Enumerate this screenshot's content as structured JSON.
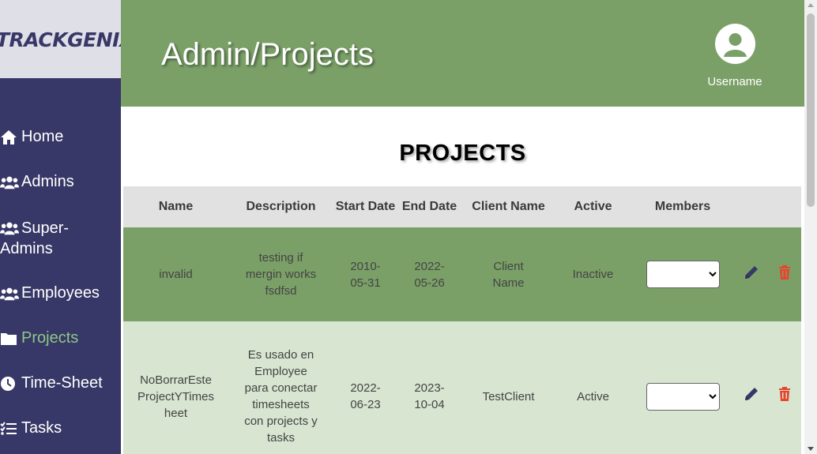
{
  "app": {
    "logo": "TRACKGENIX"
  },
  "sidebar": {
    "items": [
      {
        "label": "Home",
        "icon": "home-icon"
      },
      {
        "label": "Admins",
        "icon": "users-icon"
      },
      {
        "label": "Super-Admins",
        "label_line1": "Super-",
        "label_line2": "Admins",
        "icon": "users-icon"
      },
      {
        "label": "Employees",
        "icon": "users-icon"
      },
      {
        "label": "Projects",
        "icon": "folder-icon",
        "active": true
      },
      {
        "label": "Time-Sheet",
        "icon": "clock-icon"
      },
      {
        "label": "Tasks",
        "icon": "tasks-icon"
      }
    ]
  },
  "header": {
    "title": "Admin/Projects",
    "username": "Username"
  },
  "main": {
    "section_title": "PROJECTS",
    "columns": [
      "Name",
      "Description",
      "Start Date",
      "End Date",
      "Client Name",
      "Active",
      "Members"
    ],
    "rows": [
      {
        "name": "invalid",
        "description": "testing if mergin works fsdfsd",
        "start_date": "2010-05-31",
        "end_date": "2022-05-26",
        "client_name": "Client Name",
        "active": "Inactive",
        "members": ""
      },
      {
        "name": "NoBorrarEsteProjectYTimesheet",
        "description": "Es usado en Employee para conectar timesheets con projects y tasks",
        "start_date": "2022-06-23",
        "end_date": "2023-10-04",
        "client_name": "TestClient",
        "active": "Active",
        "members": ""
      }
    ]
  },
  "colors": {
    "sidebar_bg": "#373867",
    "header_bg": "#7aa067",
    "active_nav": "#8fc786",
    "row_odd": "#7aa067",
    "row_even": "#d7e5d1",
    "edit_icon": "#373867",
    "delete_icon": "#e8452c"
  }
}
